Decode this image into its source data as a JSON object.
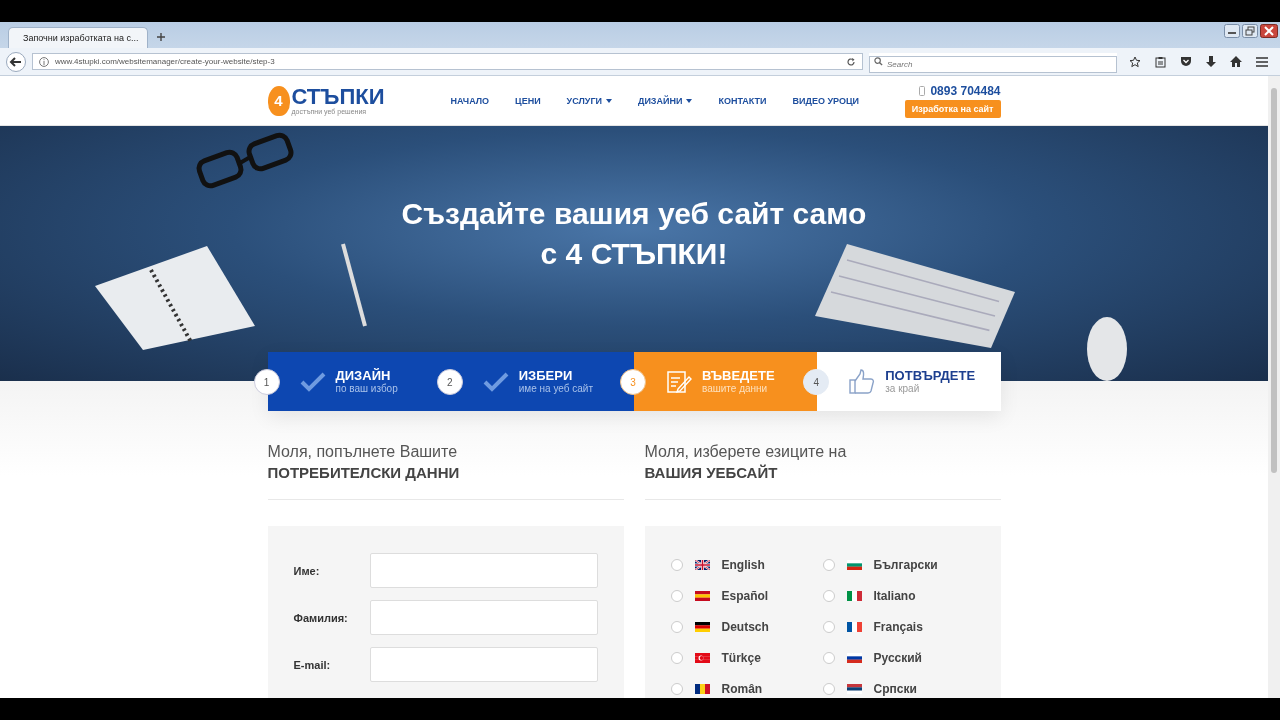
{
  "browser": {
    "tab_title": "Започни изработката на с...",
    "url": "www.4stupki.com/websitemanager/create-your-website/step-3",
    "search_placeholder": "Search"
  },
  "header": {
    "logo_digit": "4",
    "logo_text": "СТЪПКИ",
    "logo_tagline": "достъпни уеб решения",
    "phone": "0893 704484",
    "cta": "Изработка на сайт",
    "nav": [
      {
        "label": "НАЧАЛО",
        "dropdown": false
      },
      {
        "label": "ЦЕНИ",
        "dropdown": false
      },
      {
        "label": "УСЛУГИ",
        "dropdown": true
      },
      {
        "label": "ДИЗАЙНИ",
        "dropdown": true
      },
      {
        "label": "КОНТАКТИ",
        "dropdown": false
      },
      {
        "label": "ВИДЕО УРОЦИ",
        "dropdown": false
      }
    ]
  },
  "hero": {
    "title_lines": [
      "Създайте вашия уеб сайт само",
      "с 4 СТЪПКИ!"
    ]
  },
  "steps": [
    {
      "number": "1",
      "title": "ДИЗАЙН",
      "subtitle": "по ваш избор",
      "done": true,
      "selected": false
    },
    {
      "number": "2",
      "title": "ИЗБЕРИ",
      "subtitle": "име на уеб сайт",
      "done": true,
      "selected": false
    },
    {
      "number": "3",
      "title": "ВЪВЕДЕТЕ",
      "subtitle": "вашите данни",
      "done": false,
      "selected": true
    },
    {
      "number": "4",
      "title": "ПОТВЪРДЕТЕ",
      "subtitle": "за край",
      "done": false,
      "selected": false
    }
  ],
  "user_data": {
    "heading_light": "Моля, попълнете Вашите",
    "heading_bold": "ПОТРЕБИТЕЛСКИ ДАННИ",
    "fields": [
      {
        "label": "Име:"
      },
      {
        "label": "Фамилия:"
      },
      {
        "label": "E-mail:"
      }
    ]
  },
  "languages": {
    "heading_light": "Моля, изберете езиците на",
    "heading_bold": "ВАШИЯ УЕБСАЙТ",
    "options": [
      {
        "label": "English",
        "kind": "uk",
        "selected": false
      },
      {
        "label": "Български",
        "kind": "bg",
        "selected": false
      },
      {
        "label": "Español",
        "kind": "es",
        "selected": false
      },
      {
        "label": "Italiano",
        "kind": "it",
        "selected": false
      },
      {
        "label": "Deutsch",
        "kind": "de",
        "selected": false
      },
      {
        "label": "Français",
        "kind": "fr",
        "selected": false
      },
      {
        "label": "Türkçe",
        "kind": "tr",
        "selected": false
      },
      {
        "label": "Русский",
        "kind": "ru",
        "selected": false
      },
      {
        "label": "Român",
        "kind": "ro",
        "selected": false
      },
      {
        "label": "Српски",
        "kind": "rs",
        "selected": false
      }
    ]
  }
}
